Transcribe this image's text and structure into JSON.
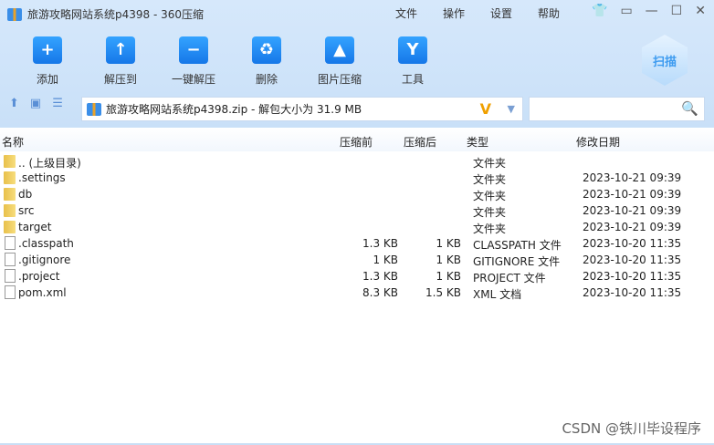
{
  "title": "旅游攻略网站系统p4398 - 360压缩",
  "menu": [
    "文件",
    "操作",
    "设置",
    "帮助"
  ],
  "toolbar": [
    {
      "label": "添加",
      "icon": "+"
    },
    {
      "label": "解压到",
      "icon": "↑"
    },
    {
      "label": "一键解压",
      "icon": "−"
    },
    {
      "label": "删除",
      "icon": "♻"
    },
    {
      "label": "图片压缩",
      "icon": "▲"
    },
    {
      "label": "工具",
      "icon": "Y"
    }
  ],
  "scan_label": "扫描",
  "path": "旅游攻略网站系统p4398.zip - 解包大小为 31.9 MB",
  "search_placeholder": "",
  "columns": [
    "名称",
    "压缩前",
    "压缩后",
    "类型",
    "修改日期"
  ],
  "rows": [
    {
      "name": ".. (上级目录)",
      "kind": "folder",
      "before": "",
      "after": "",
      "type": "文件夹",
      "date": ""
    },
    {
      "name": ".settings",
      "kind": "folder",
      "before": "",
      "after": "",
      "type": "文件夹",
      "date": "2023-10-21 09:39"
    },
    {
      "name": "db",
      "kind": "folder",
      "before": "",
      "after": "",
      "type": "文件夹",
      "date": "2023-10-21 09:39"
    },
    {
      "name": "src",
      "kind": "folder",
      "before": "",
      "after": "",
      "type": "文件夹",
      "date": "2023-10-21 09:39"
    },
    {
      "name": "target",
      "kind": "folder",
      "before": "",
      "after": "",
      "type": "文件夹",
      "date": "2023-10-21 09:39"
    },
    {
      "name": ".classpath",
      "kind": "file",
      "before": "1.3 KB",
      "after": "1 KB",
      "type": "CLASSPATH 文件",
      "date": "2023-10-20 11:35"
    },
    {
      "name": ".gitignore",
      "kind": "file",
      "before": "1 KB",
      "after": "1 KB",
      "type": "GITIGNORE 文件",
      "date": "2023-10-20 11:35"
    },
    {
      "name": ".project",
      "kind": "file",
      "before": "1.3 KB",
      "after": "1 KB",
      "type": "PROJECT 文件",
      "date": "2023-10-20 11:35"
    },
    {
      "name": "pom.xml",
      "kind": "file",
      "before": "8.3 KB",
      "after": "1.5 KB",
      "type": "XML 文档",
      "date": "2023-10-20 11:35"
    }
  ],
  "watermark": "CSDN @铁川毕设程序"
}
